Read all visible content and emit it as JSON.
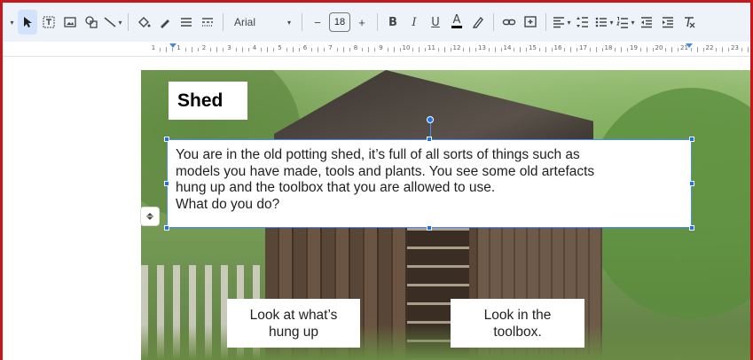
{
  "toolbar": {
    "font_name": "Arial",
    "font_size": "18",
    "minus_label": "−",
    "plus_label": "+",
    "bold_label": "B",
    "italic_label": "I",
    "underline_label": "U",
    "text_color_label": "A"
  },
  "ruler": {
    "numbers": [
      "1",
      "1",
      "2",
      "3",
      "4",
      "5",
      "6",
      "7",
      "8",
      "9",
      "10",
      "11",
      "12",
      "13",
      "14",
      "15",
      "16",
      "17",
      "18",
      "19",
      "20",
      "21",
      "22",
      "23"
    ]
  },
  "slide": {
    "title": "Shed",
    "body_lines": [
      "You are in the old potting shed, it’s full of all sorts of things such as",
      "models you have made, tools and plants.  You see some old artefacts",
      "hung up and the toolbox that you are allowed to use.",
      "What do you do?"
    ],
    "choice_left": [
      "Look at what’s",
      "hung up"
    ],
    "choice_right": [
      "Look in the",
      "toolbox."
    ]
  },
  "colors": {
    "frame": "#c8161d",
    "toolbar_bg": "#eef2f9",
    "selection": "#4c8bf5"
  }
}
